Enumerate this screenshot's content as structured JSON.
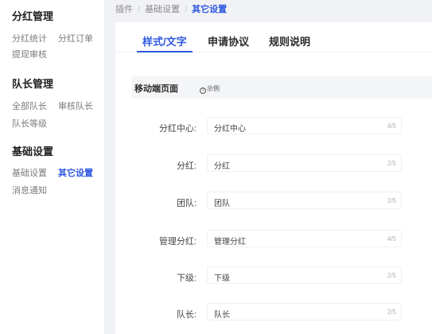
{
  "sidebar": {
    "groups": [
      {
        "title": "分红管理",
        "items": [
          "分红统计",
          "分红订单",
          "提现审核"
        ]
      },
      {
        "title": "队长管理",
        "items": [
          "全部队长",
          "审核队长",
          "队长等级"
        ]
      },
      {
        "title": "基础设置",
        "items": [
          "基础设置",
          "其它设置",
          "消息通知"
        ]
      }
    ],
    "active_item": "其它设置"
  },
  "breadcrumb": [
    "插件",
    "基础设置",
    "其它设置"
  ],
  "tabs": [
    "样式/文字",
    "申请协议",
    "规则说明"
  ],
  "active_tab": "样式/文字",
  "section": {
    "title": "移动端页面",
    "example_label": "示例",
    "example_icon": "question-circle-icon"
  },
  "fields": [
    {
      "label": "分红中心:",
      "value": "分红中心",
      "count": "4/5"
    },
    {
      "label": "分红:",
      "value": "分红",
      "count": "2/5"
    },
    {
      "label": "团队:",
      "value": "团队",
      "count": "2/5"
    },
    {
      "label": "管理分红:",
      "value": "管理分红",
      "count": "4/5"
    },
    {
      "label": "下级:",
      "value": "下级",
      "count": "2/5"
    },
    {
      "label": "队长:",
      "value": "队长",
      "count": "2/5"
    }
  ],
  "colors": {
    "accent": "#2f59e0",
    "background": "#f1f2f6"
  }
}
